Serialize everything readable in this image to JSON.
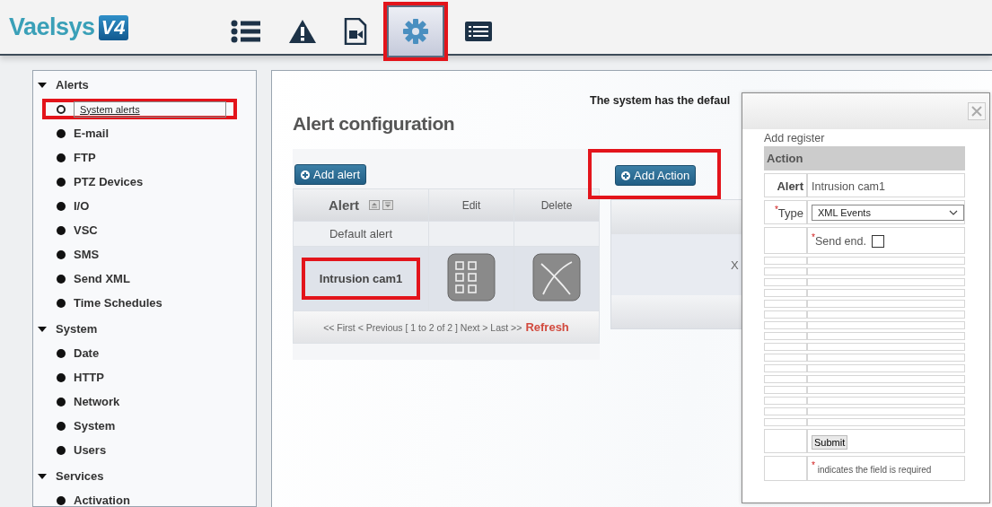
{
  "header": {
    "logo": "Vael**sys**",
    "logo_badge": "V4",
    "tabs": [
      {
        "kind": "list",
        "selected": false,
        "highlighted": false
      },
      {
        "kind": "alert",
        "selected": false,
        "highlighted": false
      },
      {
        "kind": "video",
        "selected": false,
        "highlighted": false
      },
      {
        "kind": "settings",
        "selected": true,
        "highlighted": true
      },
      {
        "kind": "details",
        "selected": false,
        "highlighted": false
      }
    ]
  },
  "sidebar": {
    "groups": [
      {
        "label": "Alerts",
        "expanded": true,
        "children": [
          {
            "label": "System alerts",
            "selected": true,
            "highlighted": true
          },
          {
            "label": "E-mail",
            "selected": false,
            "highlighted": false
          },
          {
            "label": "FTP",
            "selected": false,
            "highlighted": false
          },
          {
            "label": "PTZ Devices",
            "selected": false,
            "highlighted": false
          },
          {
            "label": "I/O",
            "selected": false,
            "highlighted": false
          },
          {
            "label": "VSC",
            "selected": false,
            "highlighted": false
          },
          {
            "label": "SMS",
            "selected": false,
            "highlighted": false
          },
          {
            "label": "Send XML",
            "selected": false,
            "highlighted": false
          },
          {
            "label": "Time Schedules",
            "selected": false,
            "highlighted": false
          }
        ]
      },
      {
        "label": "System",
        "expanded": true,
        "children": [
          {
            "label": "Date",
            "selected": false,
            "highlighted": false
          },
          {
            "label": "HTTP",
            "selected": false,
            "highlighted": false
          },
          {
            "label": "Network",
            "selected": false,
            "highlighted": false
          },
          {
            "label": "System",
            "selected": false,
            "highlighted": false
          },
          {
            "label": "Users",
            "selected": false,
            "highlighted": false
          }
        ]
      },
      {
        "label": "Services",
        "expanded": true,
        "children": [
          {
            "label": "Activation",
            "selected": false,
            "highlighted": false
          }
        ]
      }
    ]
  },
  "main": {
    "notice": "The system has the defaul",
    "title": "Alert configuration",
    "add_alert": "Add alert",
    "alerts_table": {
      "columns": [
        "Alert",
        "Edit",
        "Delete"
      ],
      "rows": [
        {
          "name": "Default alert",
          "actions": false,
          "highlighted": false
        },
        {
          "name": "Intrusion cam1",
          "actions": true,
          "highlighted": true
        }
      ],
      "pager": "<< First < Previous [ 1 to 2 of 2 ] Next > Last >>",
      "refresh": "Refresh"
    },
    "add_action": {
      "label": "Add Action",
      "highlighted": true
    },
    "actions_table": {
      "rows": [
        {
          "cell": "X"
        }
      ]
    }
  },
  "dialog": {
    "subtitle": "Add register",
    "section": "Action",
    "fields": [
      {
        "kind": "text",
        "label": "Alert",
        "value": "Intrusion cam1"
      },
      {
        "kind": "select",
        "mark": "*",
        "label": "Type",
        "value": "XML Events"
      },
      {
        "kind": "checkbox",
        "mark": "*",
        "label": "Send end.",
        "checked": false
      }
    ],
    "submit": "Submit",
    "note_mark": "*",
    "note": "indicates the field is required"
  }
}
